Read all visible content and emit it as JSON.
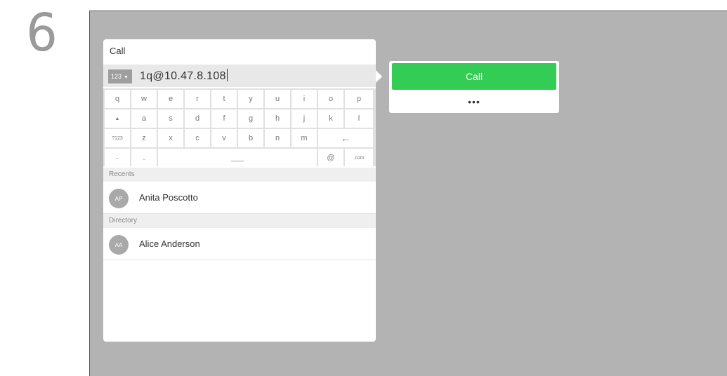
{
  "step_number": "6",
  "dialog": {
    "title": "Call",
    "input_mode": "123",
    "input_value": "1q@10.47.8.108"
  },
  "keyboard": {
    "row1": [
      "q",
      "w",
      "e",
      "r",
      "t",
      "y",
      "u",
      "i",
      "o",
      "p"
    ],
    "row2": [
      "▲",
      "a",
      "s",
      "d",
      "f",
      "g",
      "h",
      "j",
      "k",
      "l"
    ],
    "row3": [
      "?123",
      "z",
      "x",
      "c",
      "v",
      "b",
      "n",
      "m",
      "←"
    ],
    "row4": [
      "–",
      ".",
      "___",
      "@",
      ".com"
    ]
  },
  "recents": {
    "label": "Recents",
    "items": [
      {
        "initials": "AP",
        "name": "Anita Poscotto"
      }
    ]
  },
  "directory": {
    "label": "Directory",
    "items": [
      {
        "initials": "AA",
        "name": "Alice Anderson"
      }
    ]
  },
  "call_card": {
    "call_label": "Call",
    "more_label": "•••"
  },
  "colors": {
    "call_green": "#33cc55",
    "screen_gray": "#b3b3b3"
  }
}
